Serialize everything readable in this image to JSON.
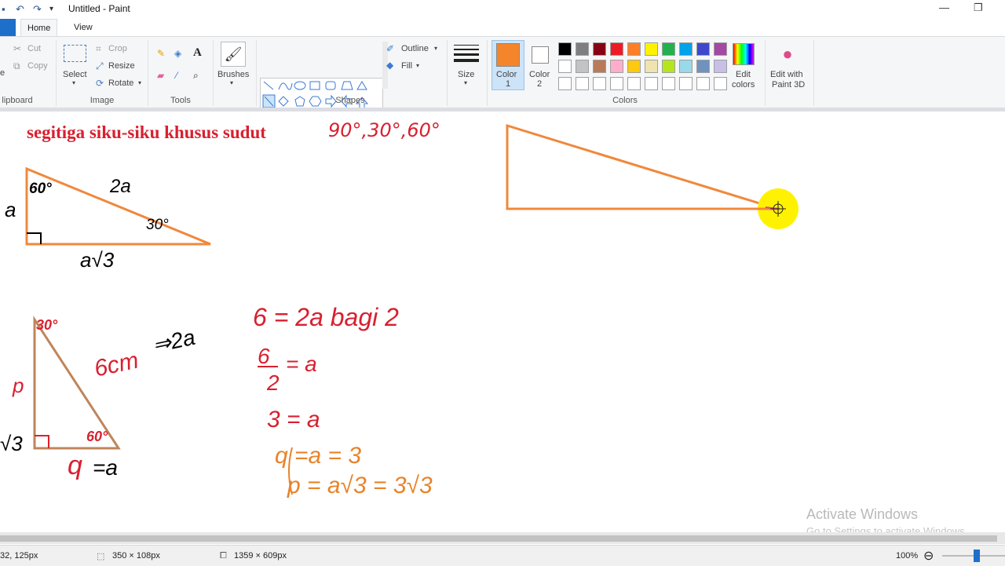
{
  "app": {
    "title": "Untitled - Paint",
    "tabs": [
      {
        "label": "Home"
      },
      {
        "label": "View"
      }
    ]
  },
  "ribbon": {
    "clipboard": {
      "cut": "Cut",
      "copy": "Copy",
      "label": "lipboard",
      "paste_fragment": "e"
    },
    "image": {
      "select": "Select",
      "crop": "Crop",
      "resize": "Resize",
      "rotate": "Rotate",
      "label": "Image"
    },
    "tools": {
      "label": "Tools"
    },
    "brushes": {
      "label": "Brushes"
    },
    "shapes": {
      "outline": "Outline",
      "fill": "Fill",
      "label": "Shapes"
    },
    "size": {
      "label": "Size"
    },
    "colors": {
      "color1_label": "Color",
      "color1_num": "1",
      "color2_label": "Color",
      "color2_num": "2",
      "edit_colors": "Edit colors",
      "edit_colors_line1": "Edit",
      "edit_colors_line2": "colors",
      "paint3d_line1": "Edit with",
      "paint3d_line2": "Paint 3D",
      "label": "Colors",
      "color1": "#f5852a",
      "color2": "#ffffff",
      "palette_row1": [
        "#000000",
        "#7f7f7f",
        "#880015",
        "#ed1c24",
        "#ff7f27",
        "#fff200",
        "#22b14c",
        "#00a2e8",
        "#3f48cc",
        "#a349a4"
      ],
      "palette_row2": [
        "#ffffff",
        "#c3c3c3",
        "#b97a57",
        "#ffaec9",
        "#ffc90e",
        "#efe4b0",
        "#b5e61d",
        "#99d9ea",
        "#7092be",
        "#c8bfe7"
      ]
    }
  },
  "canvas_text": {
    "heading": "segitiga siku-siku khusus sudut",
    "angles": "90°,30°,60°",
    "t1_60": "60°",
    "t1_2a": "2a",
    "t1_a": "a",
    "t1_30": "30°",
    "t1_ar3": "a√3",
    "t2_30": "30°",
    "t2_6cm": "6cm",
    "t2_2a": "⇒2a",
    "t2_p": "p",
    "t2_r3": "√3",
    "t2_60": "60°",
    "t2_q": "q",
    "t2_eqa": "=a",
    "eq1": "6 = 2a bagi 2",
    "eq2_num": "6",
    "eq2_den": "2",
    "eq2_rest": "= a",
    "eq3": "3 = a",
    "eq4": "q =a = 3",
    "eq5": "p = a√3 = 3√3"
  },
  "status": {
    "cursor_pos": "32, 125px",
    "selection": "350 × 108px",
    "canvas_size": "1359 × 609px",
    "zoom": "100%"
  },
  "watermark": {
    "line1": "Activate Windows",
    "line2": "Go to Settings to activate Windows."
  }
}
